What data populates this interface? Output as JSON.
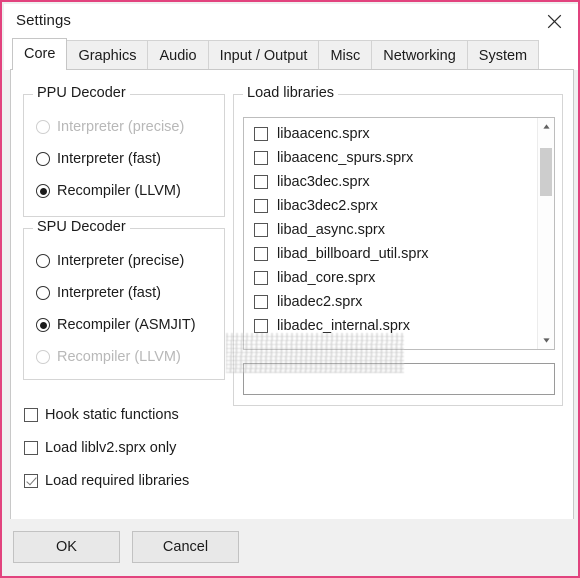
{
  "window": {
    "title": "Settings",
    "close_icon": "close-icon",
    "border_color": "#e2437e"
  },
  "tabs": [
    {
      "label": "Core",
      "selected": true
    },
    {
      "label": "Graphics",
      "selected": false
    },
    {
      "label": "Audio",
      "selected": false
    },
    {
      "label": "Input / Output",
      "selected": false
    },
    {
      "label": "Misc",
      "selected": false
    },
    {
      "label": "Networking",
      "selected": false
    },
    {
      "label": "System",
      "selected": false
    }
  ],
  "ppu_decoder": {
    "title": "PPU Decoder",
    "options": [
      {
        "label": "Interpreter (precise)",
        "checked": false,
        "disabled": true
      },
      {
        "label": "Interpreter (fast)",
        "checked": false,
        "disabled": false
      },
      {
        "label": "Recompiler (LLVM)",
        "checked": true,
        "disabled": false
      }
    ]
  },
  "spu_decoder": {
    "title": "SPU Decoder",
    "options": [
      {
        "label": "Interpreter (precise)",
        "checked": false,
        "disabled": false
      },
      {
        "label": "Interpreter (fast)",
        "checked": false,
        "disabled": false
      },
      {
        "label": "Recompiler (ASMJIT)",
        "checked": true,
        "disabled": false
      },
      {
        "label": "Recompiler (LLVM)",
        "checked": false,
        "disabled": true
      }
    ]
  },
  "core_options": [
    {
      "label": "Hook static functions",
      "checked": false
    },
    {
      "label": "Load liblv2.sprx only",
      "checked": false
    },
    {
      "label": "Load required libraries",
      "checked": true
    }
  ],
  "load_libraries": {
    "title": "Load libraries",
    "items": [
      {
        "label": "libaacenc.sprx",
        "checked": false
      },
      {
        "label": "libaacenc_spurs.sprx",
        "checked": false
      },
      {
        "label": "libac3dec.sprx",
        "checked": false
      },
      {
        "label": "libac3dec2.sprx",
        "checked": false
      },
      {
        "label": "libad_async.sprx",
        "checked": false
      },
      {
        "label": "libad_billboard_util.sprx",
        "checked": false
      },
      {
        "label": "libad_core.sprx",
        "checked": false
      },
      {
        "label": "libadec2.sprx",
        "checked": false
      },
      {
        "label": "libadec_internal.sprx",
        "checked": false
      }
    ],
    "scroll_up_icon": "scroll-up-arrow-icon",
    "scroll_down_icon": "scroll-down-arrow-icon",
    "filter_value": "",
    "filter_placeholder": ""
  },
  "watermark": {
    "text": ""
  },
  "buttons": {
    "ok": "OK",
    "cancel": "Cancel"
  }
}
